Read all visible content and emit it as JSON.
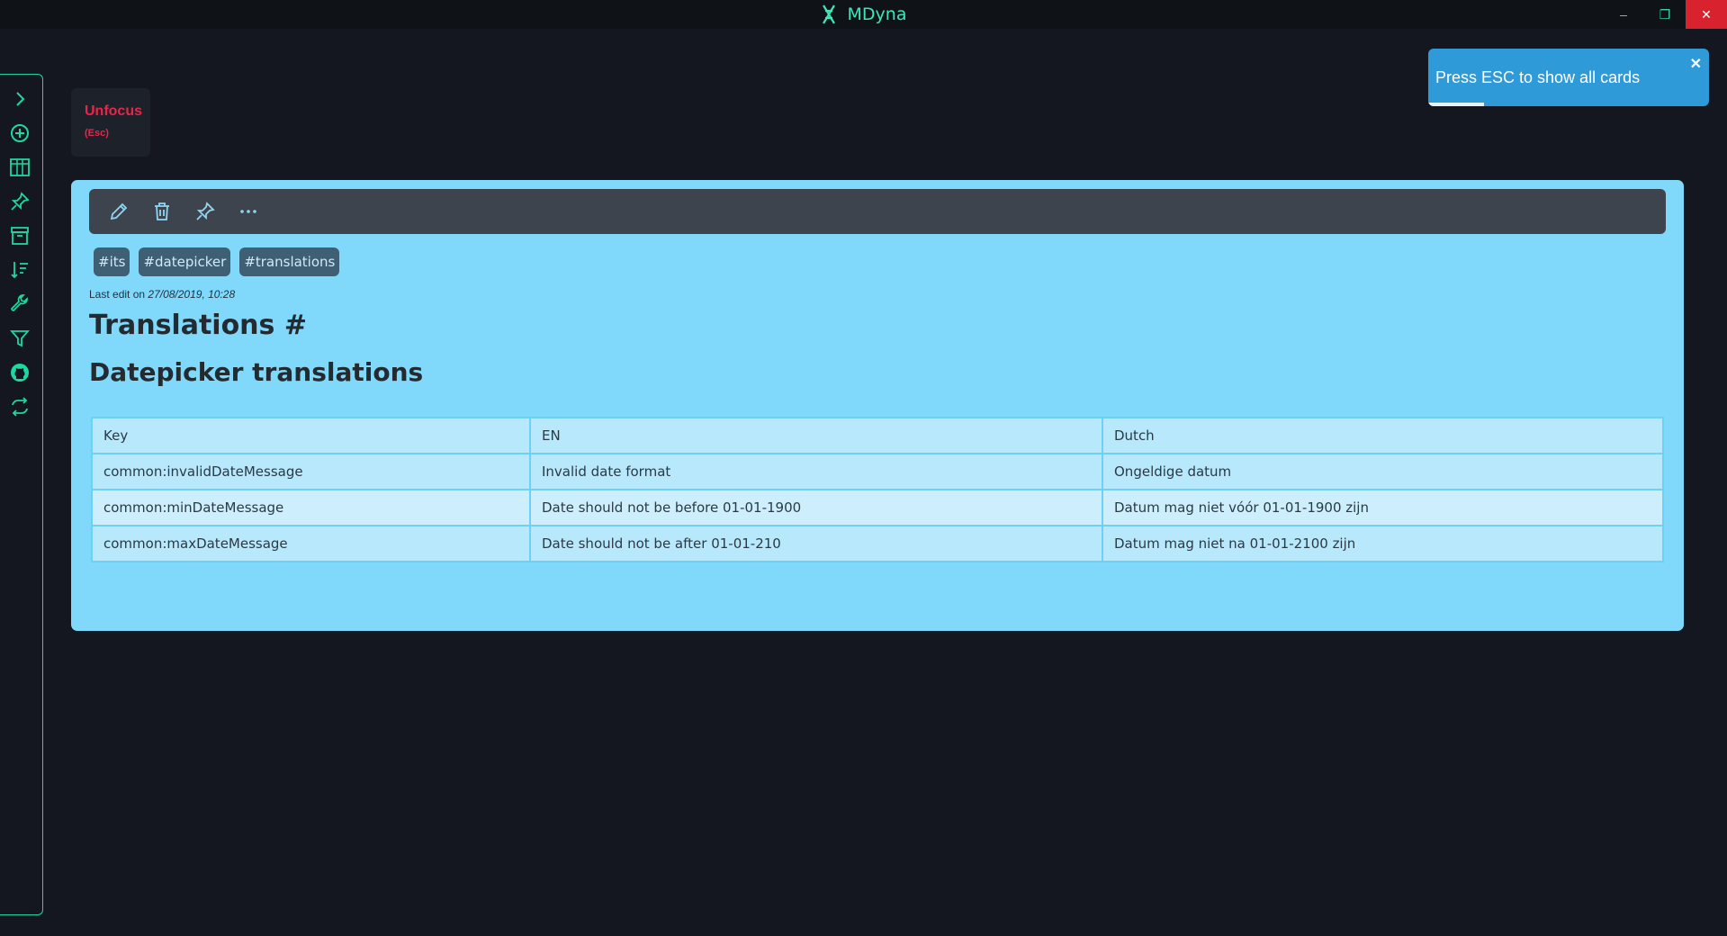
{
  "window": {
    "title": "MDyna",
    "controls": {
      "minimize": "–",
      "restore": "❐",
      "close": "✕"
    }
  },
  "sidebar": {
    "items": [
      {
        "icon": "chevron-right-icon"
      },
      {
        "icon": "add-circle-icon"
      },
      {
        "icon": "board-icon"
      },
      {
        "icon": "pin-icon"
      },
      {
        "icon": "archive-icon"
      },
      {
        "icon": "sort-icon"
      },
      {
        "icon": "wrench-icon"
      },
      {
        "icon": "filter-icon"
      },
      {
        "icon": "github-icon"
      },
      {
        "icon": "sync-icon"
      }
    ],
    "accent_color": "#1fd8a0"
  },
  "unfocus": {
    "label": "Unfocus",
    "shortcut": "(Esc)"
  },
  "toast": {
    "message": "Press ESC to show all cards",
    "close": "✕",
    "progress": 0.2
  },
  "card": {
    "tags": [
      "#its",
      "#datepicker",
      "#translations"
    ],
    "last_edit_prefix": "Last edit on",
    "last_edit_date": "27/08/2019, 10:28",
    "heading1": "Translations #",
    "heading2": "Datepicker translations",
    "table": {
      "headers": [
        "Key",
        "EN",
        "Dutch"
      ],
      "rows": [
        [
          "common:invalidDateMessage",
          "Invalid date format",
          "Ongeldige datum"
        ],
        [
          "common:minDateMessage",
          "Date should not be before 01-01-1900",
          "Datum mag niet vóór 01-01-1900 zijn"
        ],
        [
          "common:maxDateMessage",
          "Date should not be after 01-01-210",
          "Datum mag niet na 01-01-2100 zijn"
        ]
      ]
    }
  }
}
